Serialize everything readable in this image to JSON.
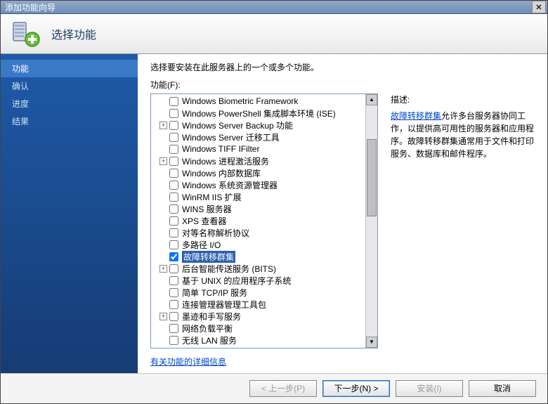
{
  "window": {
    "title": "添加功能向导"
  },
  "header": {
    "title": "选择功能"
  },
  "sidebar": {
    "steps": [
      {
        "label": "功能",
        "active": true
      },
      {
        "label": "确认"
      },
      {
        "label": "进度"
      },
      {
        "label": "结果"
      }
    ]
  },
  "main": {
    "instruction": "选择要安装在此服务器上的一个或多个功能。",
    "features_label": "功能(F):",
    "features": [
      {
        "label": "Windows Biometric Framework",
        "checked": false,
        "exp": ""
      },
      {
        "label": "Windows PowerShell 集成脚本环境 (ISE)",
        "checked": false,
        "exp": ""
      },
      {
        "label": "Windows Server Backup 功能",
        "checked": false,
        "exp": "+"
      },
      {
        "label": "Windows Server 迁移工具",
        "checked": false,
        "exp": ""
      },
      {
        "label": "Windows TIFF IFilter",
        "checked": false,
        "exp": ""
      },
      {
        "label": "Windows 进程激活服务",
        "checked": false,
        "exp": "+"
      },
      {
        "label": "Windows 内部数据库",
        "checked": false,
        "exp": ""
      },
      {
        "label": "Windows 系统资源管理器",
        "checked": false,
        "exp": ""
      },
      {
        "label": "WinRM IIS 扩展",
        "checked": false,
        "exp": ""
      },
      {
        "label": "WINS 服务器",
        "checked": false,
        "exp": ""
      },
      {
        "label": "XPS 查看器",
        "checked": false,
        "exp": ""
      },
      {
        "label": "对等名称解析协议",
        "checked": false,
        "exp": ""
      },
      {
        "label": "多路径 I/O",
        "checked": false,
        "exp": ""
      },
      {
        "label": "故障转移群集",
        "checked": true,
        "exp": "",
        "selected": true
      },
      {
        "label": "后台智能传送服务 (BITS)",
        "checked": false,
        "exp": "+"
      },
      {
        "label": "基于 UNIX 的应用程序子系统",
        "checked": false,
        "exp": ""
      },
      {
        "label": "简单 TCP/IP 服务",
        "checked": false,
        "exp": ""
      },
      {
        "label": "连接管理器管理工具包",
        "checked": false,
        "exp": ""
      },
      {
        "label": "墨迹和手写服务",
        "checked": false,
        "exp": "+"
      },
      {
        "label": "网络负载平衡",
        "checked": false,
        "exp": ""
      },
      {
        "label": "无线 LAN 服务",
        "checked": false,
        "exp": ""
      }
    ],
    "more_info": "有关功能的详细信息"
  },
  "description": {
    "title": "描述:",
    "link": "故障转移群集",
    "text": "允许多台服务器协同工作，以提供高可用性的服务器和应用程序。故障转移群集通常用于文件和打印服务、数据库和邮件程序。"
  },
  "footer": {
    "back": "< 上一步(P)",
    "next": "下一步(N) >",
    "install": "安装(I)",
    "cancel": "取消"
  },
  "icons": {
    "close": "✕",
    "plus": "+"
  }
}
